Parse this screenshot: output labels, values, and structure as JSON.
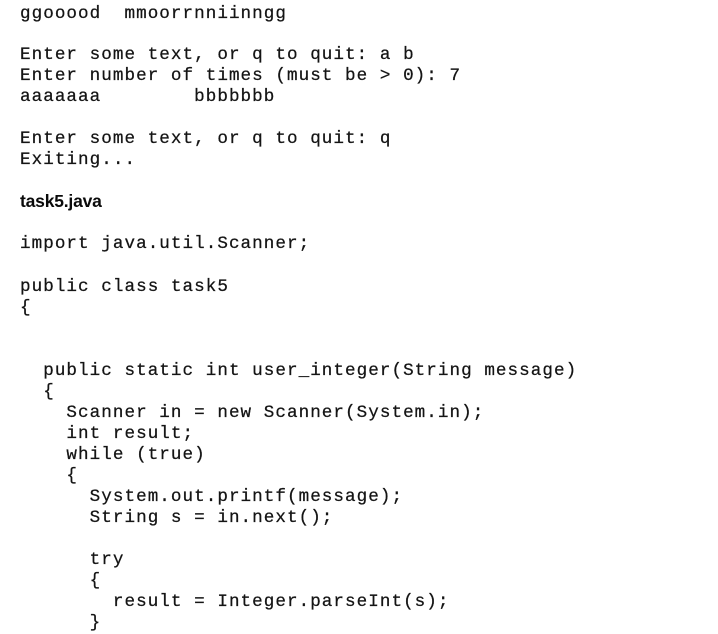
{
  "output_block": {
    "lines": [
      "ggooood  mmoorrnniinngg",
      "Enter some text, or q to quit: a b",
      "Enter number of times (must be > 0): 7",
      "aaaaaaa        bbbbbbb",
      "Enter some text, or q to quit: q",
      "Exiting..."
    ]
  },
  "section": {
    "filename": "task5.java"
  },
  "code_block": {
    "lines": [
      "import java.util.Scanner;",
      "public class task5",
      "{",
      "  public static int user_integer(String message)",
      "  {",
      "    Scanner in = new Scanner(System.in);",
      "    int result;",
      "    while (true)",
      "    {",
      "      System.out.printf(message);",
      "      String s = in.next();",
      "      try",
      "      {",
      "        result = Integer.parseInt(s);",
      "      }"
    ]
  }
}
